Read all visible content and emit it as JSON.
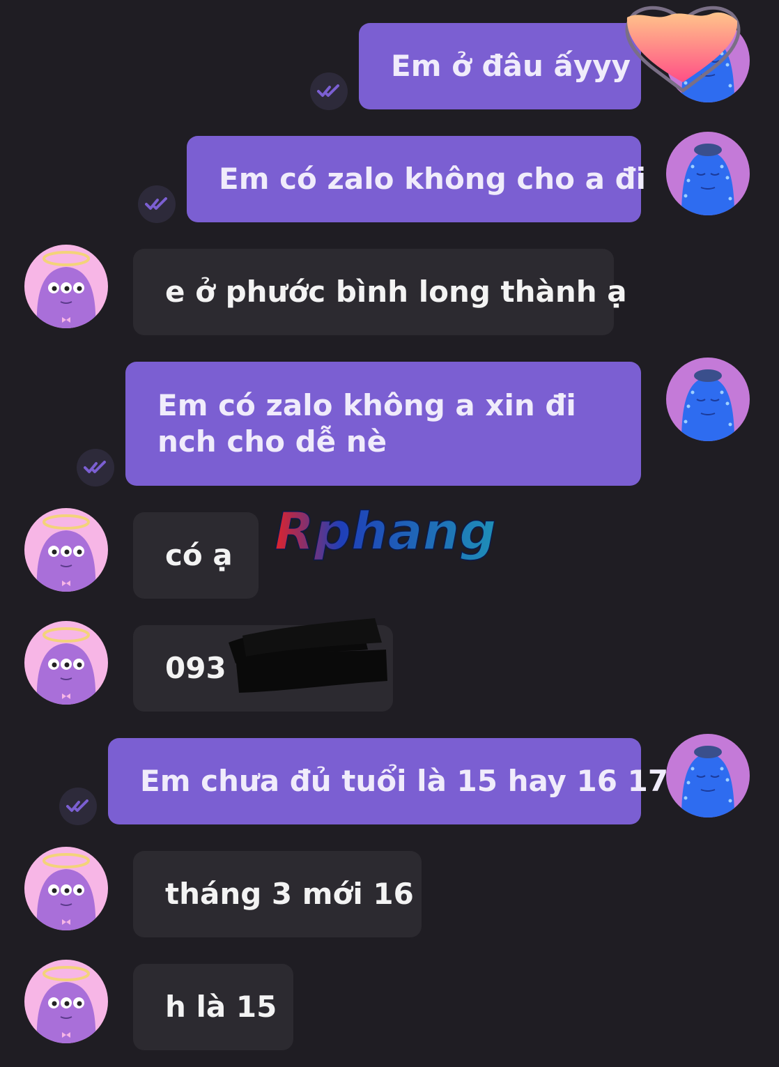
{
  "messages": [
    {
      "dir": "out",
      "text": "Em ở đâu ấyyy",
      "status": "read"
    },
    {
      "dir": "out",
      "text": "Em có zalo không cho a đi",
      "status": "read"
    },
    {
      "dir": "in",
      "text": "e ở phước bình long thành ạ"
    },
    {
      "dir": "out",
      "text": "Em có zalo không a xin đi nch cho dễ nè",
      "status": "read"
    },
    {
      "dir": "in",
      "text": "có ạ"
    },
    {
      "dir": "in",
      "text": "093"
    },
    {
      "dir": "out",
      "text": "Em chưa đủ tuổi là 15 hay 16 17",
      "status": "read"
    },
    {
      "dir": "in",
      "text": "tháng 3 mới 16"
    },
    {
      "dir": "in",
      "text": "h là 15"
    }
  ],
  "watermark": "Rphang",
  "colors": {
    "background": "#1f1d23",
    "outgoing_bubble": "#7b5fd2",
    "incoming_bubble": "#2c2a30",
    "read_check": "#7b5fd2",
    "avatar_incoming_bg": "#f7b6e6",
    "avatar_outgoing_bg": "#c47ad8"
  },
  "icons": {
    "read_receipt": "double-check-icon",
    "incoming_avatar": "purple-monster-avatar",
    "outgoing_avatar": "blue-blob-avatar",
    "reaction": "heart-icon"
  }
}
